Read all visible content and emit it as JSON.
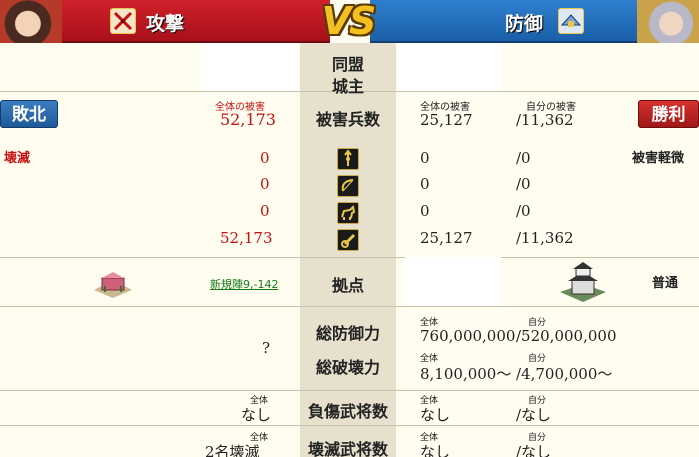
{
  "header": {
    "attacker_title": "攻撃",
    "defender_title": "防御",
    "vs_text": "VS",
    "attacker_icon": "crossed-swords-icon",
    "defender_icon": "shield-icon"
  },
  "center_labels": {
    "alliance": "同盟",
    "lord": "城主",
    "casualties": "被害兵数",
    "base": "拠点",
    "total_defense": "総防御力",
    "total_destruction": "総破壊力",
    "injured_generals": "負傷武将数",
    "destroyed_generals": "壊滅武将数"
  },
  "attacker": {
    "result_badge": "敗北",
    "status": "壊滅",
    "total_damage_label": "全体の被害",
    "total_damage": "52,173",
    "unit_losses": [
      "0",
      "0",
      "0",
      "52,173"
    ],
    "base_link": "新規陣9,-142",
    "destruction_value": "?",
    "injured_label": "全体",
    "injured_value": "なし",
    "destroyed_label": "全体",
    "destroyed_value": "2名壊滅"
  },
  "defender": {
    "result_badge": "勝利",
    "status": "被害軽微",
    "total_damage_label": "全体の被害",
    "own_damage_label": "自分の被害",
    "total_damage": "25,127",
    "own_damage": "/11,362",
    "unit_losses": [
      "0",
      "0",
      "0",
      "25,127"
    ],
    "unit_own_losses": [
      "/0",
      "/0",
      "/0",
      "/11,362"
    ],
    "base_type": "普通",
    "total_label": "全体",
    "own_label": "自分",
    "defense_total": "760,000,000",
    "defense_own": "/520,000,000",
    "destruction_total": "8,100,000〜",
    "destruction_own": "/4,700,000〜",
    "injured_total": "なし",
    "injured_own": "/なし",
    "destroyed_total": "なし",
    "destroyed_own": "/なし"
  },
  "unit_icons": [
    "spearman-icon",
    "archer-icon",
    "cavalry-icon",
    "siege-icon"
  ],
  "colors": {
    "attacker_red": "#c81010",
    "defender_blue": "#1a5fa8",
    "vs_gold": "#f4c020",
    "link_green": "#167a16"
  }
}
